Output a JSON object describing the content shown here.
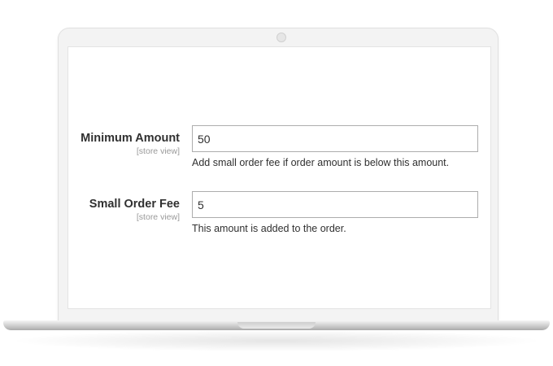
{
  "form": {
    "minimum_amount": {
      "label": "Minimum Amount",
      "scope": "[store view]",
      "value": "50",
      "note": "Add small order fee if order amount is below this amount."
    },
    "small_order_fee": {
      "label": "Small Order Fee",
      "scope": "[store view]",
      "value": "5",
      "note": "This amount is added to the order."
    }
  }
}
